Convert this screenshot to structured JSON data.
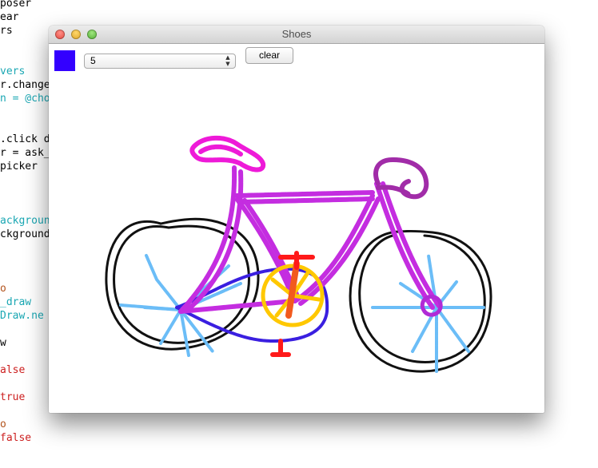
{
  "editor": {
    "lines": [
      {
        "text": "poser",
        "color": "#000000"
      },
      {
        "text": "ear",
        "color": "#000000"
      },
      {
        "text": "rs",
        "color": "#000000"
      },
      {
        "text": "vers",
        "color": "#1aa7b3"
      },
      {
        "text": "r.change",
        "color": "#000000"
      },
      {
        "text": "n = @cho",
        "color": "#1aa7b3"
      },
      {
        "text": ".click d",
        "color": "#000000"
      },
      {
        "text": "r = ask_",
        "color": "#000000"
      },
      {
        "text": "picker",
        "color": "#000000"
      },
      {
        "text": "ackgroun",
        "color": "#1aa7b3"
      },
      {
        "text": "ckground",
        "color": "#000000"
      },
      {
        "text": "o",
        "color": "#b3541e"
      },
      {
        "text": "_draw",
        "color": "#1aa7b3"
      },
      {
        "text": "Draw.ne",
        "color": "#1aa7b3"
      },
      {
        "text": "w",
        "color": "#000000"
      },
      {
        "text": "alse",
        "color": "#cc1f1f"
      },
      {
        "text": "true",
        "color": "#cc1f1f"
      },
      {
        "text": "o",
        "color": "#b3541e"
      },
      {
        "text": "false",
        "color": "#cc1f1f"
      }
    ]
  },
  "window": {
    "title": "Shoes",
    "swatch_color": "#3300ff",
    "brush_size": {
      "value": "5"
    },
    "clear_label": "clear"
  }
}
